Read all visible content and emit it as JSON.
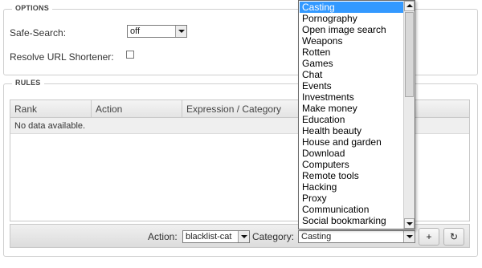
{
  "options": {
    "legend": "OPTIONS",
    "safe_search_label": "Safe-Search:",
    "safe_search_value": "off",
    "resolve_url_label": "Resolve URL Shortener:",
    "resolve_url_checked": false
  },
  "rules": {
    "legend": "RULES",
    "columns": [
      "Rank",
      "Action",
      "Expression / Category"
    ],
    "empty_text": "No data available."
  },
  "toolbar": {
    "action_label": "Action:",
    "action_value": "blacklist-cat",
    "category_label": "Category:",
    "category_value": "Casting",
    "add_icon": "+",
    "refresh_icon": "↻"
  },
  "category_dropdown": {
    "selected": "Casting",
    "items": [
      "Casting",
      "Pornography",
      "Open image search",
      "Weapons",
      "Rotten",
      "Games",
      "Chat",
      "Events",
      "Investments",
      "Make money",
      "Education",
      "Health beauty",
      "House and garden",
      "Download",
      "Computers",
      "Remote tools",
      "Hacking",
      "Proxy",
      "Communication",
      "Social bookmarking"
    ]
  }
}
